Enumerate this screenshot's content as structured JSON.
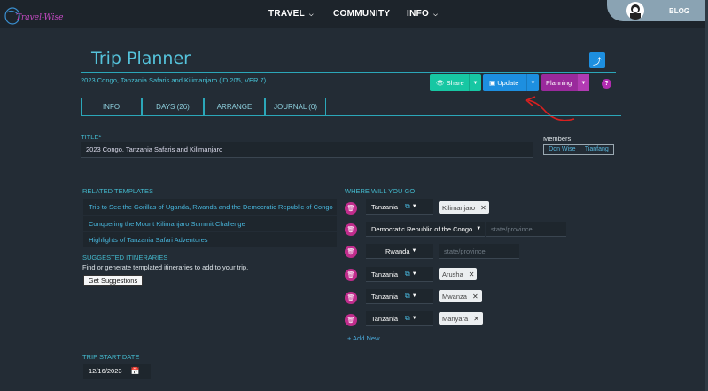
{
  "nav": {
    "logo_text": "Travel-Wise",
    "travel": "TRAVEL",
    "community": "COMMUNITY",
    "info": "INFO",
    "blog": "BLOG"
  },
  "page": {
    "title": "Trip Planner",
    "subtitle": "2023 Congo, Tanzania Safaris and Kilimanjaro (ID 205, VER 7)"
  },
  "toolbar": {
    "share": "Share",
    "update": "Update",
    "planning": "Planning",
    "help": "?"
  },
  "tabs": [
    "INFO",
    "DAYS (26)",
    "ARRANGE",
    "JOURNAL (0)"
  ],
  "form": {
    "title_label": "TITLE*",
    "title_value": "2023 Congo, Tanzania Safaris and Kilimanjaro",
    "members_label": "Members",
    "members": [
      "Don Wise",
      "Tianfang"
    ]
  },
  "related": {
    "label": "RELATED TEMPLATES",
    "items": [
      "Trip to See the Gorillas of Uganda, Rwanda and the Democratic Republic of Congo",
      "Conquering the Mount Kilimanjaro Summit Challenge",
      "Highlights of Tanzania Safari Adventures"
    ]
  },
  "suggested": {
    "label": "SUGGESTED ITINERARIES",
    "description": "Find or generate templated itineraries to add to your trip.",
    "button": "Get Suggestions"
  },
  "destinations": {
    "label": "WHERE WILL YOU GO",
    "placeholder": "state/province",
    "rows": [
      {
        "country": "Tanzania",
        "place": "Kilimanjaro"
      },
      {
        "country": "Democratic Republic of the Congo",
        "place": ""
      },
      {
        "country": "Rwanda",
        "place": ""
      },
      {
        "country": "Tanzania",
        "place": "Arusha"
      },
      {
        "country": "Tanzania",
        "place": "Mwanza"
      },
      {
        "country": "Tanzania",
        "place": "Manyara"
      }
    ],
    "add_new": "+ Add New"
  },
  "start": {
    "label": "TRIP START DATE",
    "value": "12/16/2023"
  },
  "colors": {
    "accent": "#2ba7b9",
    "share": "#17c7a3",
    "update": "#1d8fe0",
    "planning": "#9a2a9c",
    "trash": "#c02c8c"
  }
}
